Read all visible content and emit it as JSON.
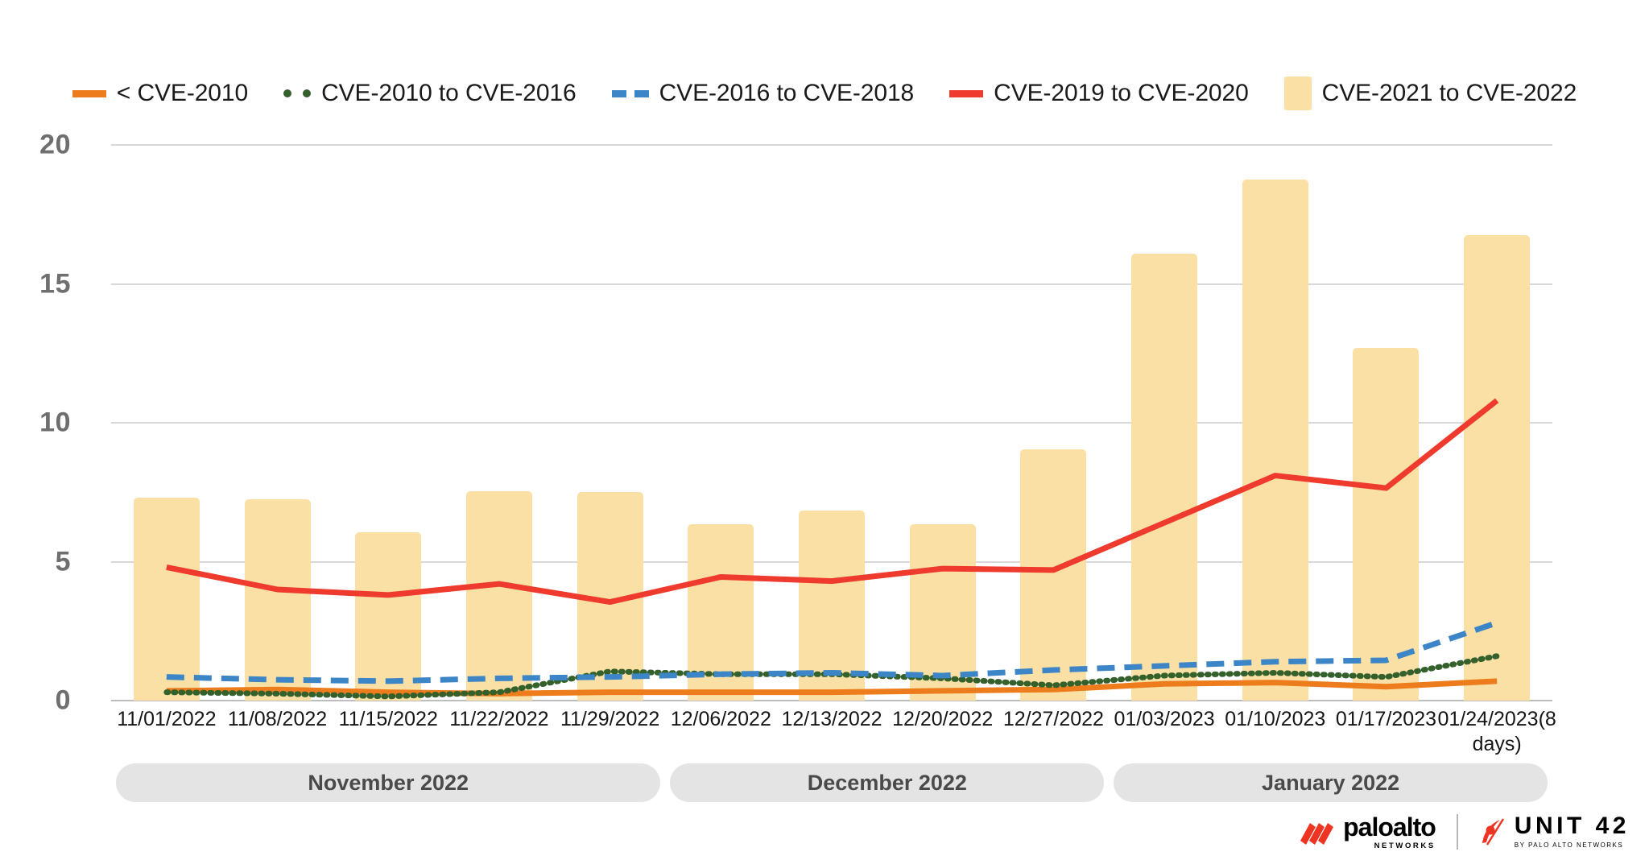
{
  "chart_data": {
    "type": "bar",
    "title": "",
    "subtitle": "",
    "xlabel": "",
    "ylabel": "",
    "ylim": [
      0,
      20
    ],
    "yticks": [
      0,
      5,
      10,
      15,
      20
    ],
    "ytick_labels": [
      "0",
      "5",
      "10",
      "15",
      "20"
    ],
    "grid": true,
    "legend_position": "top-center",
    "categories": [
      "11/01/2022",
      "11/08/2022",
      "11/15/2022",
      "11/22/2022",
      "11/29/2022",
      "12/06/2022",
      "12/13/2022",
      "12/20/2022",
      "12/27/2022",
      "01/03/2023",
      "01/10/2023",
      "01/17/2023",
      "01/24/2023(8 days)"
    ],
    "series": [
      {
        "name": "< CVE-2010",
        "type": "line",
        "color": "#ED7D1C",
        "dash": "solid",
        "values": [
          0.35,
          0.4,
          0.3,
          0.25,
          0.3,
          0.3,
          0.3,
          0.35,
          0.4,
          0.6,
          0.65,
          0.5,
          0.7
        ]
      },
      {
        "name": "CVE-2010 to CVE-2016",
        "type": "line",
        "color": "#34602C",
        "dash": "dotted",
        "values": [
          0.3,
          0.25,
          0.15,
          0.3,
          1.05,
          0.95,
          0.95,
          0.8,
          0.55,
          0.9,
          1.0,
          0.85,
          1.6
        ]
      },
      {
        "name": "CVE-2016 to CVE-2018",
        "type": "line",
        "color": "#3C85C6",
        "dash": "dashed",
        "values": [
          0.85,
          0.75,
          0.7,
          0.8,
          0.85,
          0.95,
          1.0,
          0.9,
          1.1,
          1.25,
          1.4,
          1.45,
          2.8
        ]
      },
      {
        "name": "CVE-2019 to CVE-2020",
        "type": "line",
        "color": "#EE3B2D",
        "dash": "solid",
        "values": [
          4.8,
          4.0,
          3.8,
          4.2,
          3.55,
          4.45,
          4.3,
          4.75,
          4.7,
          6.4,
          8.1,
          7.65,
          10.8
        ]
      },
      {
        "name": "CVE-2021 to CVE-2022",
        "type": "bar",
        "color": "#FAE0A4",
        "values": [
          7.3,
          7.25,
          6.05,
          7.55,
          7.5,
          6.35,
          6.85,
          6.35,
          9.05,
          16.1,
          18.75,
          12.7,
          16.75
        ]
      }
    ],
    "group_bands": [
      {
        "label": "November 2022",
        "start_index": 0,
        "end_index": 4
      },
      {
        "label": "December 2022",
        "start_index": 5,
        "end_index": 8
      },
      {
        "label": "January 2022",
        "start_index": 9,
        "end_index": 12
      }
    ]
  },
  "footer": {
    "paloalto_wordmark": "paloalto",
    "paloalto_tagline": "NETWORKS",
    "unit42_wordmark": "UNIT 42",
    "unit42_tagline": "BY PALO ALTO NETWORKS"
  }
}
